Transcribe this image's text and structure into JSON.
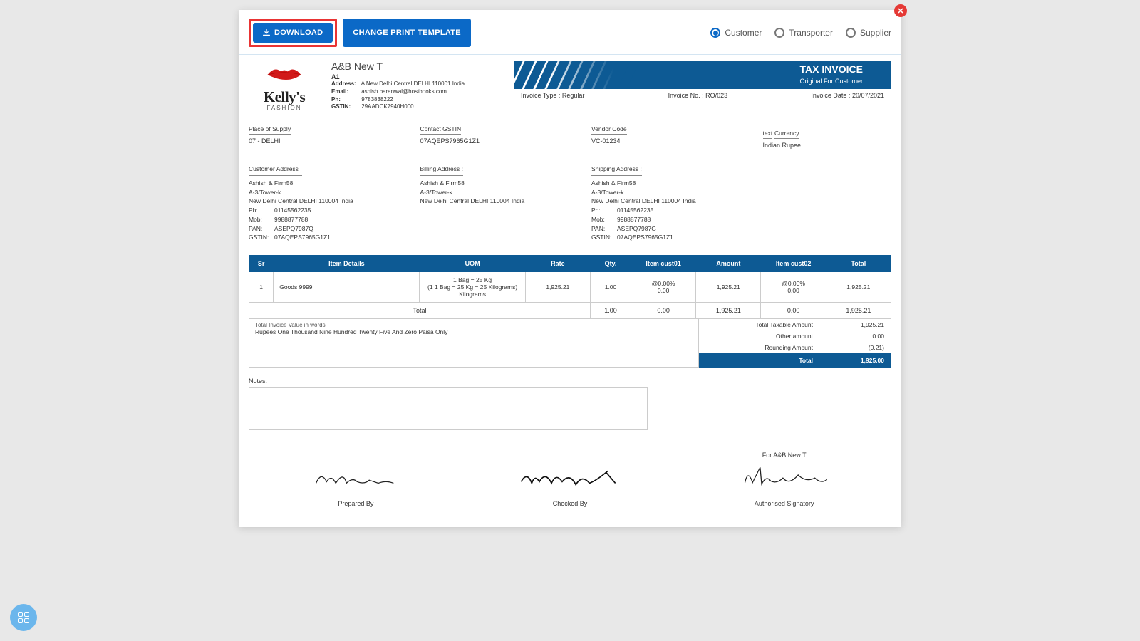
{
  "toolbar": {
    "download_label": "DOWNLOAD",
    "change_template_label": "CHANGE PRINT TEMPLATE",
    "radios": {
      "customer": "Customer",
      "transporter": "Transporter",
      "supplier": "Supplier"
    }
  },
  "logo": {
    "name": "Kelly's",
    "sub": "FASHION"
  },
  "company": {
    "title": "A&B New T",
    "code": "A1",
    "address_label": "Address:",
    "address": "A New Delhi Central DELHI 110001 India",
    "email_label": "Email:",
    "email": "ashish.baranwal@hostbooks.com",
    "ph_label": "Ph:",
    "ph": "9783838222",
    "gstin_label": "GSTIN:",
    "gstin": "29AADCK7940H000"
  },
  "tax_invoice": {
    "title": "TAX INVOICE",
    "subtitle": "Original For Customer"
  },
  "meta": {
    "type_label": "Invoice Type :",
    "type": "Regular",
    "no_label": "Invoice No. :",
    "no": "RO/023",
    "date_label": "Invoice Date :",
    "date": "20/07/2021"
  },
  "info": {
    "place_label": "Place of Supply",
    "place": "07 - DELHI",
    "gstin_label": "Contact GSTIN",
    "gstin": "07AQEPS7965G1Z1",
    "vendor_label": "Vendor Code",
    "vendor": "VC-01234",
    "text_label": "text",
    "currency_label": "Currency",
    "currency": "Indian Rupee"
  },
  "addresses": {
    "customer": {
      "label": "Customer Address :",
      "name": "Ashish & Firm58",
      "l1": "A-3/Tower-k",
      "l2": "New Delhi Central DELHI 110004 India",
      "ph_lbl": "Ph:",
      "ph": "01145562235",
      "mob_lbl": "Mob:",
      "mob": "9988877788",
      "pan_lbl": "PAN:",
      "pan": "ASEPQ7987Q",
      "gstin_lbl": "GSTIN:",
      "gstin": "07AQEPS7965G1Z1"
    },
    "billing": {
      "label": "Billing Address :",
      "name": "Ashish & Firm58",
      "l1": "A-3/Tower-k",
      "l2": "New Delhi Central DELHI 110004 India"
    },
    "shipping": {
      "label": "Shipping Address :",
      "name": "Ashish & Firm58",
      "l1": "A-3/Tower-k",
      "l2": "New Delhi Central DELHI 110004 India",
      "ph_lbl": "Ph:",
      "ph": "01145562235",
      "mob_lbl": "Mob:",
      "mob": "9988877788",
      "pan_lbl": "PAN:",
      "pan": "ASEPQ7987G",
      "gstin_lbl": "GSTIN:",
      "gstin": "07AQEPS7965G1Z1"
    }
  },
  "headers": [
    "Sr",
    "Item Details",
    "UOM",
    "Rate",
    "Qty.",
    "Item cust01",
    "Amount",
    "Item cust02",
    "Total"
  ],
  "row": {
    "sr": "1",
    "item": "Goods 9999",
    "uom1": "1 Bag = 25 Kg",
    "uom2": "(1 1 Bag = 25 Kg = 25 Kilograms)",
    "uom3": "Kilograms",
    "rate": "1,925.21",
    "qty": "1.00",
    "c1a": "@0.00%",
    "c1b": "0.00",
    "amount": "1,925.21",
    "c2a": "@0.00%",
    "c2b": "0.00",
    "total": "1,925.21"
  },
  "total_row": {
    "label": "Total",
    "qty": "1.00",
    "c1": "0.00",
    "amount": "1,925.21",
    "c2": "0.00",
    "total": "1,925.21"
  },
  "in_words": {
    "label": "Total Invoice Value in words",
    "value": "Rupees One Thousand Nine Hundred Twenty Five And Zero Paisa Only"
  },
  "totals": {
    "taxable_label": "Total Taxable Amount",
    "taxable": "1,925.21",
    "other_label": "Other amount",
    "other": "0.00",
    "round_label": "Rounding Amount",
    "round": "(0.21)",
    "grand_label": "Total",
    "grand": "1,925.00"
  },
  "notes_label": "Notes:",
  "signatures": {
    "for_label": "For A&B New T",
    "prepared": "Prepared By",
    "checked": "Checked By",
    "auth": "Authorised Signatory"
  }
}
